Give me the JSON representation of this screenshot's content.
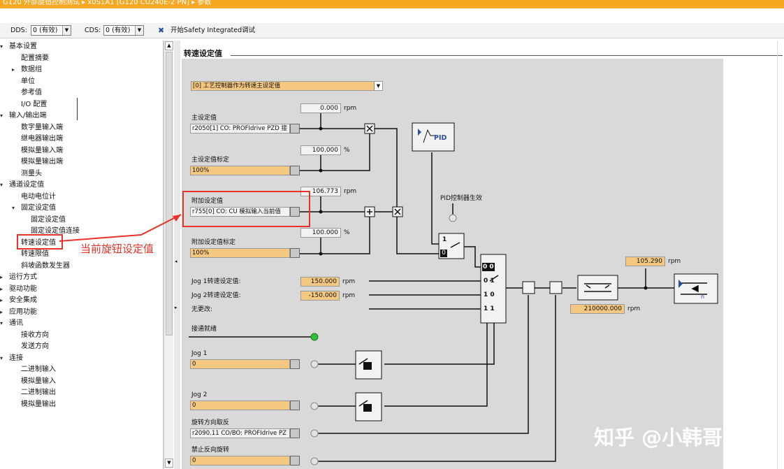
{
  "titlebar": {
    "text": "G120 外部旋钮控制测试 ▸ x0S1A1 [G120 CU240E-2 PN] ▸ 参数"
  },
  "toolbar": {
    "dds_label": "DDS:",
    "dds_value": "0 (有效)",
    "cds_label": "CDS:",
    "cds_value": "0 (有效)",
    "safety_label": "开始Safety Integrated调试"
  },
  "tree": [
    {
      "label": "基本设置",
      "exp": "▾"
    },
    {
      "label": "配置摘要"
    },
    {
      "label": "数据组",
      "exp": "▸"
    },
    {
      "label": "单位"
    },
    {
      "label": "参考值"
    },
    {
      "label": "I/O 配置"
    },
    {
      "label": "输入/输出端",
      "exp": "▾"
    },
    {
      "label": "数字量输入端"
    },
    {
      "label": "继电器输出端"
    },
    {
      "label": "模拟量输入端"
    },
    {
      "label": "模拟量输出端"
    },
    {
      "label": "测量头"
    },
    {
      "label": "通道设定值",
      "exp": "▾"
    },
    {
      "label": "电动电位计"
    },
    {
      "label": "固定设定值",
      "exp": "▾"
    },
    {
      "label": "固定设定值"
    },
    {
      "label": "固定设定值连接"
    },
    {
      "label": "转速设定值"
    },
    {
      "label": "转速限值"
    },
    {
      "label": "斜坡函数发生器"
    },
    {
      "label": "运行方式",
      "exp": "▸"
    },
    {
      "label": "驱动功能",
      "exp": "▸"
    },
    {
      "label": "安全集成",
      "exp": "▸"
    },
    {
      "label": "应用功能",
      "exp": "▸"
    },
    {
      "label": "通讯",
      "exp": "▾"
    },
    {
      "label": "接收方向"
    },
    {
      "label": "发送方向"
    },
    {
      "label": "连接",
      "exp": "▾"
    },
    {
      "label": "二进制输入"
    },
    {
      "label": "模拟量输入"
    },
    {
      "label": "二进制输出"
    },
    {
      "label": "模拟量输出"
    }
  ],
  "annotation": {
    "text": "当前旋钮设定值",
    "color": "#e8332a"
  },
  "page": {
    "section_title": "转速设定值"
  },
  "diagram": {
    "mode_select": "[0] 工艺控制器作为转速主设定值",
    "main_sp": {
      "label": "主设定值",
      "source": "r2050[1] CO: PROFIdrive PZD 接",
      "value": "0.000",
      "unit": "rpm"
    },
    "main_scale": {
      "label": "主设定值标定",
      "value": "100%",
      "readout": "100.000",
      "unit": "%"
    },
    "add_sp": {
      "label": "附加设定值",
      "source": "r755[0] CO: CU 模拟输入当前值",
      "value": "106.773",
      "unit": "rpm"
    },
    "add_scale": {
      "label": "附加设定值标定",
      "value": "100%",
      "readout": "100.000",
      "unit": "%"
    },
    "pid_label": "PID",
    "pid_active": "PID控制器生效",
    "jog1": {
      "label": "Jog 1转速设定值:",
      "value": "150.000",
      "unit": "rpm"
    },
    "jog2": {
      "label": "Jog 2转速设定值:",
      "value": "-150.000",
      "unit": "rpm"
    },
    "nochange": "无更改:",
    "codes": [
      "0 0",
      "0 1",
      "1 0",
      "1 1"
    ],
    "sw_1": "1",
    "sw_0": "0",
    "out_value": "105.290",
    "out_unit": "rpm",
    "limit_value": "210000.000",
    "limit_unit": "rpm",
    "ready": "接通就绪",
    "jog1_in": {
      "label": "Jog 1",
      "value": "0"
    },
    "jog2_in": {
      "label": "Jog 2",
      "value": "0"
    },
    "reverse": {
      "label": "旋转方向取反",
      "source": "r2090.11 CO/BO: PROFIdrive PZ"
    },
    "forbid": {
      "label": "禁止反向旋转",
      "value": "0"
    },
    "n_label": "n"
  },
  "watermark": "知乎 @小韩哥哥"
}
